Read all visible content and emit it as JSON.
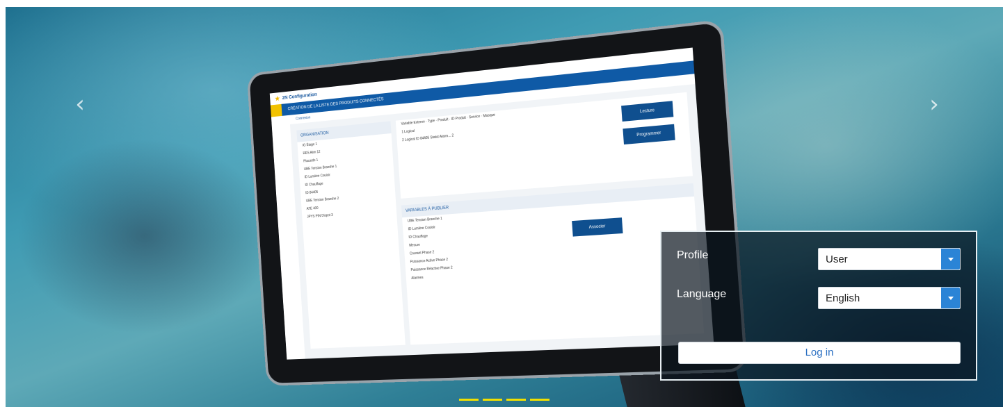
{
  "carousel": {
    "prev_label": "‹",
    "next_label": "›",
    "indicator_count": 4
  },
  "tablet_app": {
    "title": "2N Configuration",
    "header": "CRÉATION DE LA LISTE DES PRODUITS CONNECTÉS",
    "tab": "Connexion",
    "panel_left_title": "ORGANISATION",
    "panel_left_items": [
      "IG Étage 1",
      "RES Alim 12",
      "Placards 1",
      "UBE Tension Branche 1",
      "ID Lumière Couloir",
      "ID Chauffage",
      "ID 84405",
      "UBE Tension Branche 2",
      "ATE 400",
      "JPYS PIN Dispot 3"
    ],
    "table_headers": [
      "Variable Externe",
      "Type",
      "Produit",
      "ID Produit",
      "Service",
      "Masque"
    ],
    "table_rows": [
      [
        "1",
        "Logical",
        "",
        "",
        "",
        ""
      ],
      [
        "2",
        "Logical",
        "ID",
        "84405",
        "Statut Alarm...",
        "2"
      ]
    ],
    "btn_lecture": "Lecture",
    "btn_programmer": "Programmer",
    "panel_bottom_title": "VARIABLES À PUBLIER",
    "panel_bottom_items": [
      "UBE Tension Branche 1",
      "ID Lumière Couloir",
      "ID Chauffage",
      "Mesure",
      "Courant Phase 2",
      "Puissance Active Phase 2",
      "Puissance Réactive Phase 2",
      "Alarmes"
    ],
    "btn_associer": "Associer"
  },
  "login": {
    "profile_label": "Profile",
    "profile_value": "User",
    "language_label": "Language",
    "language_value": "English",
    "login_button": "Log in"
  },
  "colors": {
    "accent": "#2b84d6",
    "indicator": "#f2e000",
    "login_text": "#2a6fc2"
  }
}
